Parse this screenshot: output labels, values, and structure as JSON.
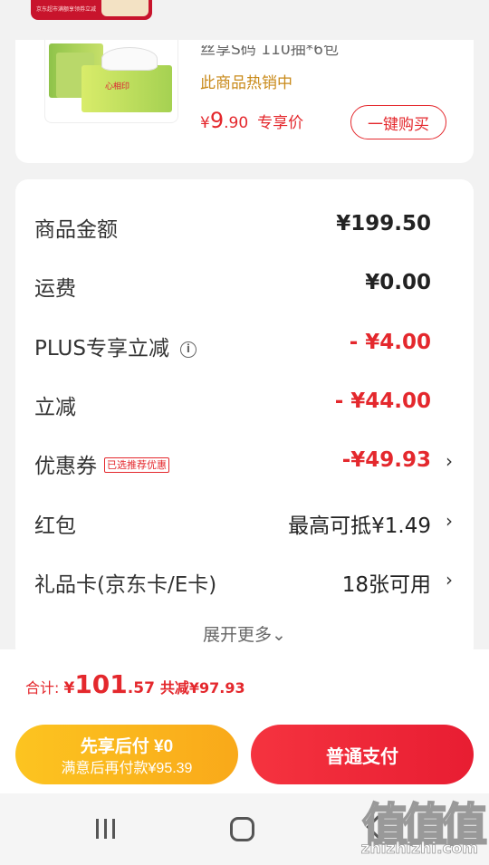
{
  "banner": {
    "tiny_text": "京东超市满额享领券立减"
  },
  "product": {
    "spec": "丝享S码 110抽*6包",
    "image_label": "心相印",
    "hot_sale": "此商品热销中",
    "price_symbol": "¥",
    "price_int": "9",
    "price_dec": ".90",
    "price_tag": "专享价",
    "buy_label": "一键购买"
  },
  "summary": {
    "goods_amount": {
      "label": "商品金额",
      "value": "¥199.50"
    },
    "shipping": {
      "label": "运费",
      "value": "¥0.00"
    },
    "plus_discount": {
      "label": "PLUS专享立减",
      "info_icon": "i",
      "value": "- ¥4.00"
    },
    "instant_discount": {
      "label": "立减",
      "value": "- ¥44.00"
    },
    "coupon": {
      "label": "优惠券",
      "badge": "已选推荐优惠",
      "value": "-¥49.93"
    },
    "red_packet": {
      "label": "红包",
      "value": "最高可抵¥1.49"
    },
    "gift_card": {
      "label": "礼品卡(京东卡/E卡)",
      "value": "18张可用"
    },
    "chevron": "›",
    "expand_label": "展开更多⌄"
  },
  "total": {
    "label": "合计: ",
    "yen": "¥",
    "amount_int": "101",
    "amount_dec": ".57",
    "saved": "共减¥97.93"
  },
  "pay": {
    "later_title": "先享后付 ¥0",
    "later_sub": "满意后再付款¥95.39",
    "pay_label": "普通支付"
  },
  "watermark": {
    "glyphs": "值值值",
    "url": "zhizhizhi.com"
  },
  "colors": {
    "accent": "#e4282d",
    "gold": "#f9a91a",
    "hot": "#c98a1a"
  }
}
